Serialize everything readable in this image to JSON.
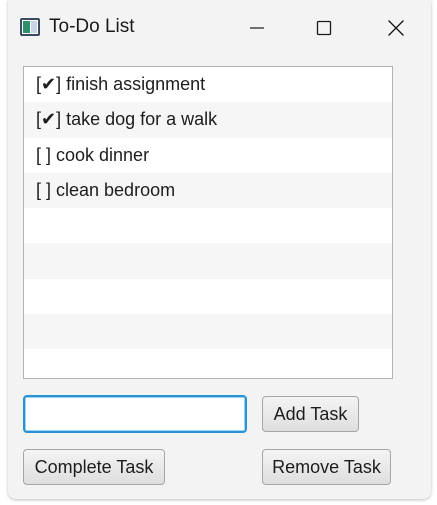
{
  "window": {
    "title": "To-Do List"
  },
  "icons": {
    "app": "app-window-icon",
    "minimize": "minimize-icon",
    "maximize": "maximize-icon",
    "close": "close-icon"
  },
  "tasks": [
    {
      "label": "[✔] finish assignment"
    },
    {
      "label": "[✔] take dog for a walk"
    },
    {
      "label": "[ ] cook dinner"
    },
    {
      "label": "[ ] clean bedroom"
    },
    {
      "label": ""
    },
    {
      "label": ""
    },
    {
      "label": ""
    },
    {
      "label": ""
    },
    {
      "label": ""
    }
  ],
  "input": {
    "value": ""
  },
  "buttons": {
    "add": "Add Task",
    "complete": "Complete Task",
    "remove": "Remove Task"
  },
  "colors": {
    "focus_border": "#2a93d5",
    "window_bg": "#f3f3f3",
    "row_alt": "#f6f6f6"
  }
}
